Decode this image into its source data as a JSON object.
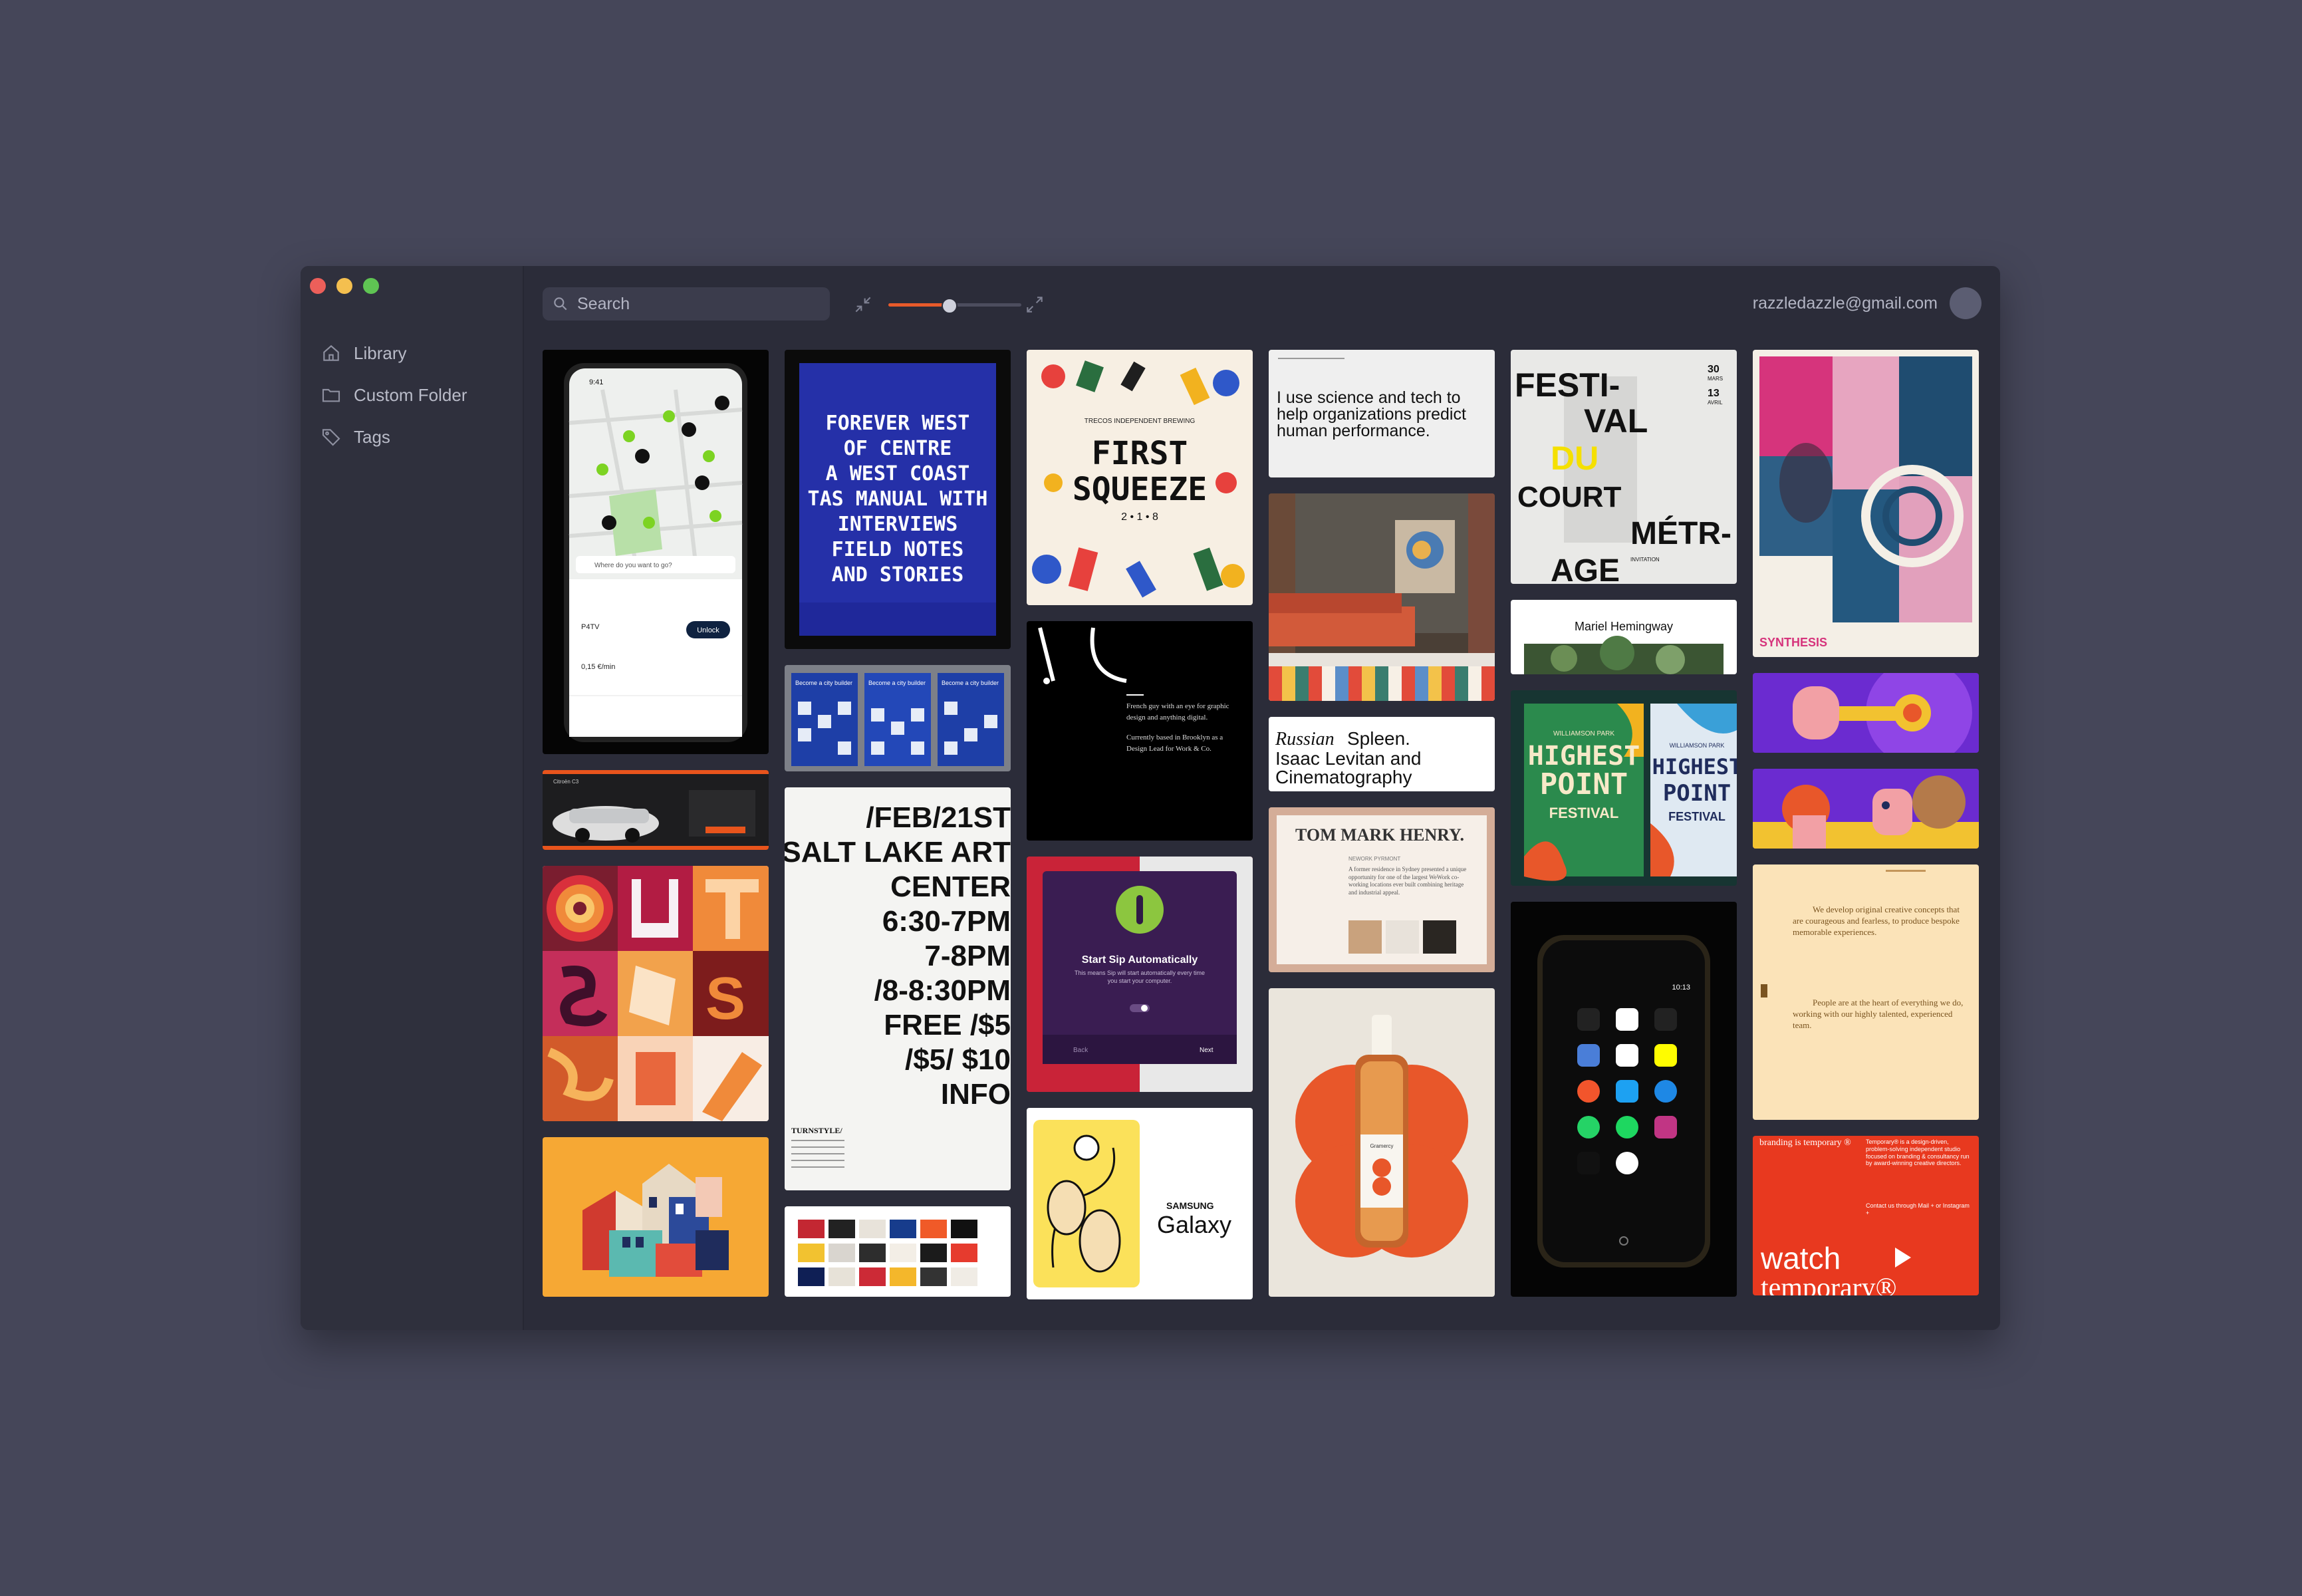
{
  "sidebar": {
    "items": [
      {
        "label": "Library",
        "icon": "home-icon"
      },
      {
        "label": "Custom Folder",
        "icon": "folder-icon"
      },
      {
        "label": "Tags",
        "icon": "tag-icon"
      }
    ]
  },
  "toolbar": {
    "search_placeholder": "Search",
    "zoom_level": 0.45,
    "user_email": "razzledazzle@gmail.com"
  },
  "colors": {
    "accent": "#e85a2a",
    "background": "#454659",
    "window": "#2b2c39"
  },
  "cards": {
    "map_app": {
      "search": "Where do you want to go?",
      "unlock": "Unlock",
      "price": "0,15 €/min",
      "vehicle": "P4TV",
      "time": "9:41"
    },
    "forever_west": {
      "lines": [
        "FOREVER WEST",
        "OF CENTRE",
        "A WEST COAST",
        "TAS MANUAL WITH",
        "INTERVIEWS",
        "FIELD NOTES",
        "AND STORIES"
      ]
    },
    "city_builder": {
      "label": "Become a city builder"
    },
    "first_squeeze": {
      "top": "TRECOS INDEPENDENT BREWING",
      "title1": "FIRST",
      "title2": "SQUEEZE",
      "year": "2 • 1 • 8"
    },
    "science": {
      "text": "I use science and tech to help organizations predict human performance."
    },
    "festival_court": {
      "lines": [
        "FESTI-",
        "VAL",
        "DU",
        "COURT",
        "MÉTR-",
        "AGE"
      ],
      "date1": "30",
      "month1": "MARS",
      "date2": "13",
      "month2": "AVRIL",
      "footer": "INVITATION"
    },
    "synthesis": {
      "title": "SYNTHESIS"
    },
    "salt_lake": {
      "lines": [
        "/FEB/21ST",
        "SALT LAKE ART",
        "CENTER",
        "6:30-7PM",
        "7-8PM",
        "/8-8:30PM",
        "FREE /$5",
        "/$5/ $10",
        "INFO"
      ],
      "brand": "TURNSTYLE/"
    },
    "dark_bio": {
      "text1": "French guy with an eye for graphic design and anything digital.",
      "text2": "Currently based in Brooklyn as a Design Lead for Work & Co."
    },
    "russian": {
      "text1": "Russian",
      "text2": "Spleen.",
      "text3": "Isaac Levitan and",
      "text4": "Cinematography"
    },
    "mariel": {
      "name": "Mariel Hemingway"
    },
    "highest": {
      "top": "WILLIAMSON PARK",
      "line1": "HIGHEST",
      "line2": "POINT",
      "line3": "FESTIVAL"
    },
    "tom_mark": {
      "title": "TOM MARK HENRY.",
      "sub": "NEWORK PYRMONT",
      "body": "A former residence in Sydney presented a unique opportunity for one of the largest WeWork co-working locations ever built combining heritage and industrial appeal."
    },
    "sip": {
      "title": "Start Sip Automatically",
      "body": "This means Sip will start automatically every time you start your computer.",
      "back": "Back",
      "next": "Next"
    },
    "temporary_text": {
      "p1": "We develop original creative concepts that are courageous and fearless, to produce bespoke memorable experiences.",
      "p2": "People are at the heart of everything we do, working with our highly talented, experienced team."
    },
    "samsung": {
      "brand": "SAMSUNG",
      "product": "Galaxy"
    },
    "bottle": {
      "label": "Gramercy"
    },
    "phone_icons": {
      "time": "10:13"
    },
    "temporary_red": {
      "top_left": "branding is temporary ®",
      "top_right": "Temporary® is a design-driven, problem-solving independent studio focused on branding & consultancy run by award-winning creative directors.",
      "contact": "Contact us through Mail + or Instagram +",
      "watch": "watch",
      "temporary": "temporary®"
    },
    "car": {
      "title": "Citroën C3"
    }
  }
}
